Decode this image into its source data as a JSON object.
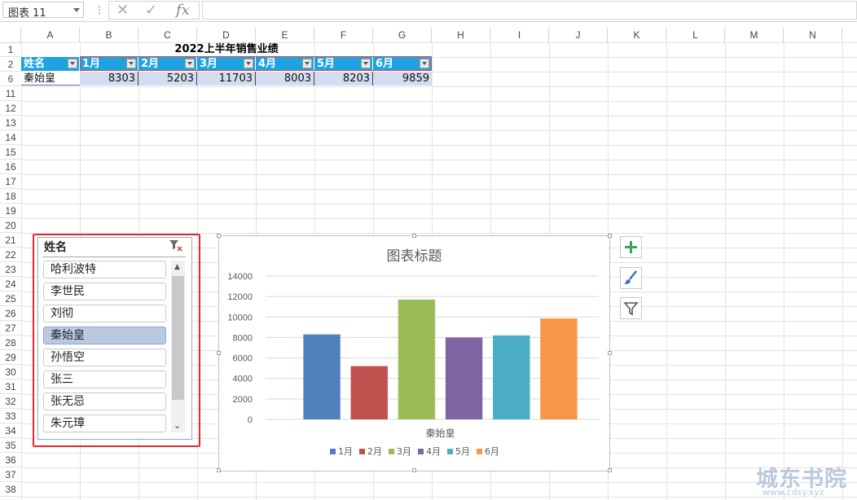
{
  "formula_bar": {
    "name_box": "图表 11",
    "separator": "⋮",
    "cancel_label": "✕",
    "enter_label": "✓",
    "fx_label": "fx",
    "formula": ""
  },
  "columns": [
    "A",
    "B",
    "C",
    "D",
    "E",
    "F",
    "G",
    "H",
    "I",
    "J",
    "K",
    "L",
    "M",
    "N"
  ],
  "rows": [
    "1",
    "2",
    "6",
    "11",
    "12",
    "13",
    "14",
    "15",
    "16",
    "17",
    "18",
    "19",
    "20",
    "21",
    "22",
    "23",
    "24",
    "25",
    "26",
    "27",
    "28",
    "29",
    "30",
    "31",
    "32",
    "33",
    "34",
    "35",
    "36",
    "37",
    "38"
  ],
  "table": {
    "title": "2022上半年销售业绩",
    "headers": [
      "姓名",
      "1月",
      "2月",
      "3月",
      "4月",
      "5月",
      "6月"
    ],
    "row": {
      "name": "秦始皇",
      "values": [
        "8303",
        "5203",
        "11703",
        "8003",
        "8203",
        "9859"
      ]
    }
  },
  "slicer": {
    "title": "姓名",
    "items": [
      "哈利波特",
      "李世民",
      "刘彻",
      "秦始皇",
      "孙悟空",
      "张三",
      "张无忌",
      "朱元璋"
    ],
    "selected": "秦始皇",
    "scroll_up": "▲",
    "scroll_down": "⌄"
  },
  "chart_data": {
    "type": "bar",
    "title": "图表标题",
    "categories": [
      "秦始皇"
    ],
    "xlabel": "秦始皇",
    "ylim": [
      0,
      14000
    ],
    "yticks": [
      "0",
      "2000",
      "4000",
      "6000",
      "8000",
      "10000",
      "12000",
      "14000"
    ],
    "grid": true,
    "legend_position": "bottom",
    "series": [
      {
        "name": "1月",
        "values": [
          8303
        ],
        "color": "#4f81bd"
      },
      {
        "name": "2月",
        "values": [
          5203
        ],
        "color": "#c0504d"
      },
      {
        "name": "3月",
        "values": [
          11703
        ],
        "color": "#9bbb59"
      },
      {
        "name": "4月",
        "values": [
          8003
        ],
        "color": "#8064a2"
      },
      {
        "name": "5月",
        "values": [
          8203
        ],
        "color": "#4bacc6"
      },
      {
        "name": "6月",
        "values": [
          9859
        ],
        "color": "#f79646"
      }
    ]
  },
  "chart_tools": [
    "add-element-icon",
    "chart-style-icon",
    "chart-filter-icon"
  ],
  "watermark": {
    "main": "城东书院",
    "sub": "www.cdsy.xyz"
  },
  "colors": {
    "header_blue": "#1fa3e0",
    "selection_red": "#e8272f",
    "selected_item": "#b9c9e3"
  }
}
